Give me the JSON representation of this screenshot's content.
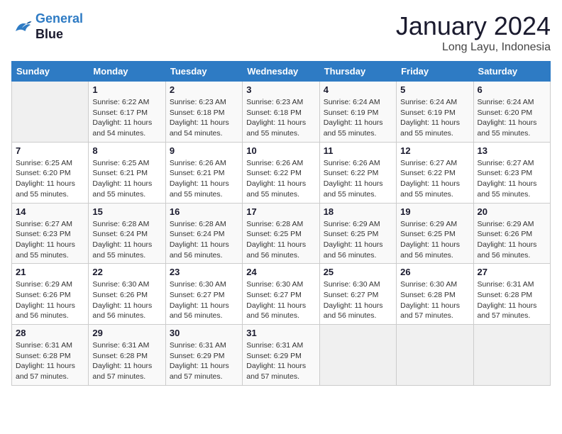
{
  "header": {
    "logo_line1": "General",
    "logo_line2": "Blue",
    "month": "January 2024",
    "location": "Long Layu, Indonesia"
  },
  "weekdays": [
    "Sunday",
    "Monday",
    "Tuesday",
    "Wednesday",
    "Thursday",
    "Friday",
    "Saturday"
  ],
  "weeks": [
    [
      {
        "day": "",
        "info": ""
      },
      {
        "day": "1",
        "info": "Sunrise: 6:22 AM\nSunset: 6:17 PM\nDaylight: 11 hours and 54 minutes."
      },
      {
        "day": "2",
        "info": "Sunrise: 6:23 AM\nSunset: 6:18 PM\nDaylight: 11 hours and 54 minutes."
      },
      {
        "day": "3",
        "info": "Sunrise: 6:23 AM\nSunset: 6:18 PM\nDaylight: 11 hours and 55 minutes."
      },
      {
        "day": "4",
        "info": "Sunrise: 6:24 AM\nSunset: 6:19 PM\nDaylight: 11 hours and 55 minutes."
      },
      {
        "day": "5",
        "info": "Sunrise: 6:24 AM\nSunset: 6:19 PM\nDaylight: 11 hours and 55 minutes."
      },
      {
        "day": "6",
        "info": "Sunrise: 6:24 AM\nSunset: 6:20 PM\nDaylight: 11 hours and 55 minutes."
      }
    ],
    [
      {
        "day": "7",
        "info": "Sunrise: 6:25 AM\nSunset: 6:20 PM\nDaylight: 11 hours and 55 minutes."
      },
      {
        "day": "8",
        "info": "Sunrise: 6:25 AM\nSunset: 6:21 PM\nDaylight: 11 hours and 55 minutes."
      },
      {
        "day": "9",
        "info": "Sunrise: 6:26 AM\nSunset: 6:21 PM\nDaylight: 11 hours and 55 minutes."
      },
      {
        "day": "10",
        "info": "Sunrise: 6:26 AM\nSunset: 6:22 PM\nDaylight: 11 hours and 55 minutes."
      },
      {
        "day": "11",
        "info": "Sunrise: 6:26 AM\nSunset: 6:22 PM\nDaylight: 11 hours and 55 minutes."
      },
      {
        "day": "12",
        "info": "Sunrise: 6:27 AM\nSunset: 6:22 PM\nDaylight: 11 hours and 55 minutes."
      },
      {
        "day": "13",
        "info": "Sunrise: 6:27 AM\nSunset: 6:23 PM\nDaylight: 11 hours and 55 minutes."
      }
    ],
    [
      {
        "day": "14",
        "info": "Sunrise: 6:27 AM\nSunset: 6:23 PM\nDaylight: 11 hours and 55 minutes."
      },
      {
        "day": "15",
        "info": "Sunrise: 6:28 AM\nSunset: 6:24 PM\nDaylight: 11 hours and 55 minutes."
      },
      {
        "day": "16",
        "info": "Sunrise: 6:28 AM\nSunset: 6:24 PM\nDaylight: 11 hours and 56 minutes."
      },
      {
        "day": "17",
        "info": "Sunrise: 6:28 AM\nSunset: 6:25 PM\nDaylight: 11 hours and 56 minutes."
      },
      {
        "day": "18",
        "info": "Sunrise: 6:29 AM\nSunset: 6:25 PM\nDaylight: 11 hours and 56 minutes."
      },
      {
        "day": "19",
        "info": "Sunrise: 6:29 AM\nSunset: 6:25 PM\nDaylight: 11 hours and 56 minutes."
      },
      {
        "day": "20",
        "info": "Sunrise: 6:29 AM\nSunset: 6:26 PM\nDaylight: 11 hours and 56 minutes."
      }
    ],
    [
      {
        "day": "21",
        "info": "Sunrise: 6:29 AM\nSunset: 6:26 PM\nDaylight: 11 hours and 56 minutes."
      },
      {
        "day": "22",
        "info": "Sunrise: 6:30 AM\nSunset: 6:26 PM\nDaylight: 11 hours and 56 minutes."
      },
      {
        "day": "23",
        "info": "Sunrise: 6:30 AM\nSunset: 6:27 PM\nDaylight: 11 hours and 56 minutes."
      },
      {
        "day": "24",
        "info": "Sunrise: 6:30 AM\nSunset: 6:27 PM\nDaylight: 11 hours and 56 minutes."
      },
      {
        "day": "25",
        "info": "Sunrise: 6:30 AM\nSunset: 6:27 PM\nDaylight: 11 hours and 56 minutes."
      },
      {
        "day": "26",
        "info": "Sunrise: 6:30 AM\nSunset: 6:28 PM\nDaylight: 11 hours and 57 minutes."
      },
      {
        "day": "27",
        "info": "Sunrise: 6:31 AM\nSunset: 6:28 PM\nDaylight: 11 hours and 57 minutes."
      }
    ],
    [
      {
        "day": "28",
        "info": "Sunrise: 6:31 AM\nSunset: 6:28 PM\nDaylight: 11 hours and 57 minutes."
      },
      {
        "day": "29",
        "info": "Sunrise: 6:31 AM\nSunset: 6:28 PM\nDaylight: 11 hours and 57 minutes."
      },
      {
        "day": "30",
        "info": "Sunrise: 6:31 AM\nSunset: 6:29 PM\nDaylight: 11 hours and 57 minutes."
      },
      {
        "day": "31",
        "info": "Sunrise: 6:31 AM\nSunset: 6:29 PM\nDaylight: 11 hours and 57 minutes."
      },
      {
        "day": "",
        "info": ""
      },
      {
        "day": "",
        "info": ""
      },
      {
        "day": "",
        "info": ""
      }
    ]
  ]
}
